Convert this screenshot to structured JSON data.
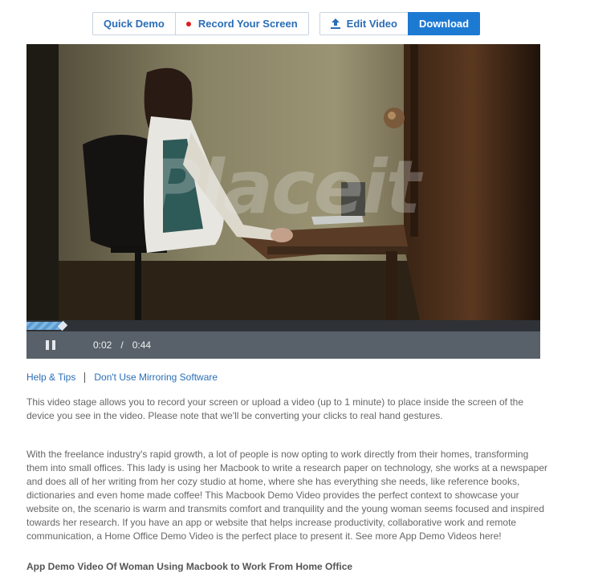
{
  "toolbar": {
    "quick_demo": "Quick Demo",
    "record_screen": "Record Your Screen",
    "edit_video": "Edit Video",
    "download": "Download"
  },
  "video": {
    "watermark": "Placeit",
    "current_time": "0:02",
    "separator": "/",
    "duration": "0:44",
    "progress_fraction": 0.07
  },
  "links": {
    "help": "Help & Tips",
    "mirroring": "Don't Use Mirroring Software"
  },
  "description": {
    "intro": "This video stage allows you to record your screen or upload a video (up to 1 minute) to place inside the screen of the device you see in the video. Please note that we'll be converting your clicks to real hand gestures.",
    "body": "With the freelance industry's rapid growth, a lot of people is now opting to work directly from their homes, transforming them into small offices. This lady is using her Macbook to write a research paper on technology, she works at a newspaper and does all of her writing from her cozy studio at home, where she has everything she needs, like reference books, dictionaries and even home made coffee! This Macbook Demo Video provides the perfect context to showcase your website on, the scenario is warm and transmits comfort and tranquility and the young woman seems focused and inspired towards her research. If you have an app or website that helps increase productivity, collaborative work and remote communication, a Home Office Demo Video is the perfect place to present it. See more App Demo Videos here!",
    "heading": "App Demo Video Of Woman Using Macbook to Work From Home Office"
  },
  "colors": {
    "link_blue": "#2a6db6",
    "primary_button": "#1d7ad3",
    "record_dot": "#e01b1b"
  }
}
